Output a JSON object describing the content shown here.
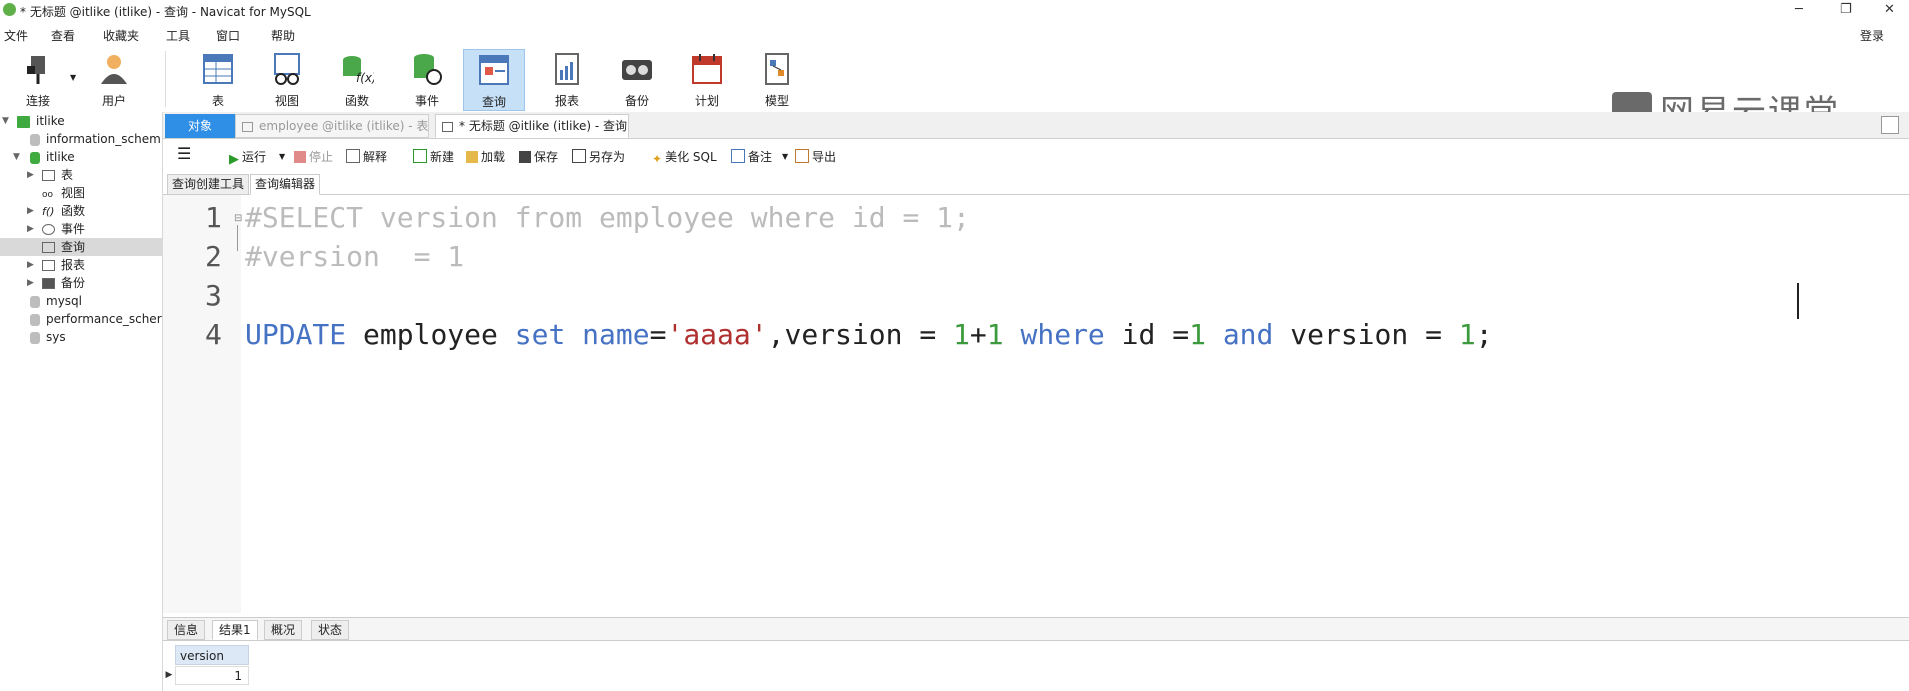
{
  "window": {
    "title": "* 无标题 @itlike (itlike) - 查询 - Navicat for MySQL",
    "minimize": "─",
    "restore": "❐",
    "close": "✕"
  },
  "menu": {
    "items": [
      "文件",
      "查看",
      "收藏夹",
      "工具",
      "窗口",
      "帮助"
    ],
    "login": "登录"
  },
  "toolbar": {
    "items": [
      {
        "label": "连接",
        "icon": "plug-icon"
      },
      {
        "label": "用户",
        "icon": "user-icon"
      },
      {
        "label": "表",
        "icon": "table-icon"
      },
      {
        "label": "视图",
        "icon": "view-icon"
      },
      {
        "label": "函数",
        "icon": "function-icon"
      },
      {
        "label": "事件",
        "icon": "event-icon"
      },
      {
        "label": "查询",
        "icon": "query-icon"
      },
      {
        "label": "报表",
        "icon": "report-icon"
      },
      {
        "label": "备份",
        "icon": "backup-icon"
      },
      {
        "label": "计划",
        "icon": "schedule-icon"
      },
      {
        "label": "模型",
        "icon": "model-icon"
      }
    ],
    "brand": "网易云课堂"
  },
  "tree": {
    "items": [
      {
        "label": "itlike"
      },
      {
        "label": "information_schem"
      },
      {
        "label": "itlike"
      },
      {
        "label": "表"
      },
      {
        "label": "视图"
      },
      {
        "label": "函数"
      },
      {
        "label": "事件"
      },
      {
        "label": "查询"
      },
      {
        "label": "报表"
      },
      {
        "label": "备份"
      },
      {
        "label": "mysql"
      },
      {
        "label": "performance_scher"
      },
      {
        "label": "sys"
      }
    ]
  },
  "tabs": [
    {
      "label": "对象"
    },
    {
      "label": "employee @itlike (itlike) - 表"
    },
    {
      "label": "* 无标题 @itlike (itlike) - 查询"
    }
  ],
  "query_toolbar": {
    "run": "运行",
    "stop": "停止",
    "explain": "解释",
    "new": "新建",
    "load": "加载",
    "save": "保存",
    "save_as": "另存为",
    "beautify": "美化 SQL",
    "comment": "备注",
    "export": "导出"
  },
  "sub_tabs": [
    "查询创建工具",
    "查询编辑器"
  ],
  "editor": {
    "line_numbers": [
      "1",
      "2",
      "3",
      "4"
    ],
    "line1": "#SELECT version from employee where id = 1;",
    "line2": "#version  = 1",
    "line4": {
      "kw_update": "UPDATE",
      "t_table": " employee ",
      "kw_set": "set",
      "t_space": " ",
      "kw_name": "name",
      "t_eq": "=",
      "s_val": "'aaaa'",
      "t_ver": ",version = ",
      "n1": "1",
      "t_plus": "+",
      "n2": "1",
      "t_sp2": " ",
      "kw_where": "where",
      "t_id": " id =",
      "n3": "1",
      "t_sp3": " ",
      "kw_and": "and",
      "t_ver2": " version = ",
      "n4": "1",
      "t_semi": ";"
    }
  },
  "results": {
    "tabs": [
      "信息",
      "结果1",
      "概况",
      "状态"
    ],
    "columns": [
      "version"
    ],
    "rows": [
      [
        "1"
      ]
    ]
  }
}
